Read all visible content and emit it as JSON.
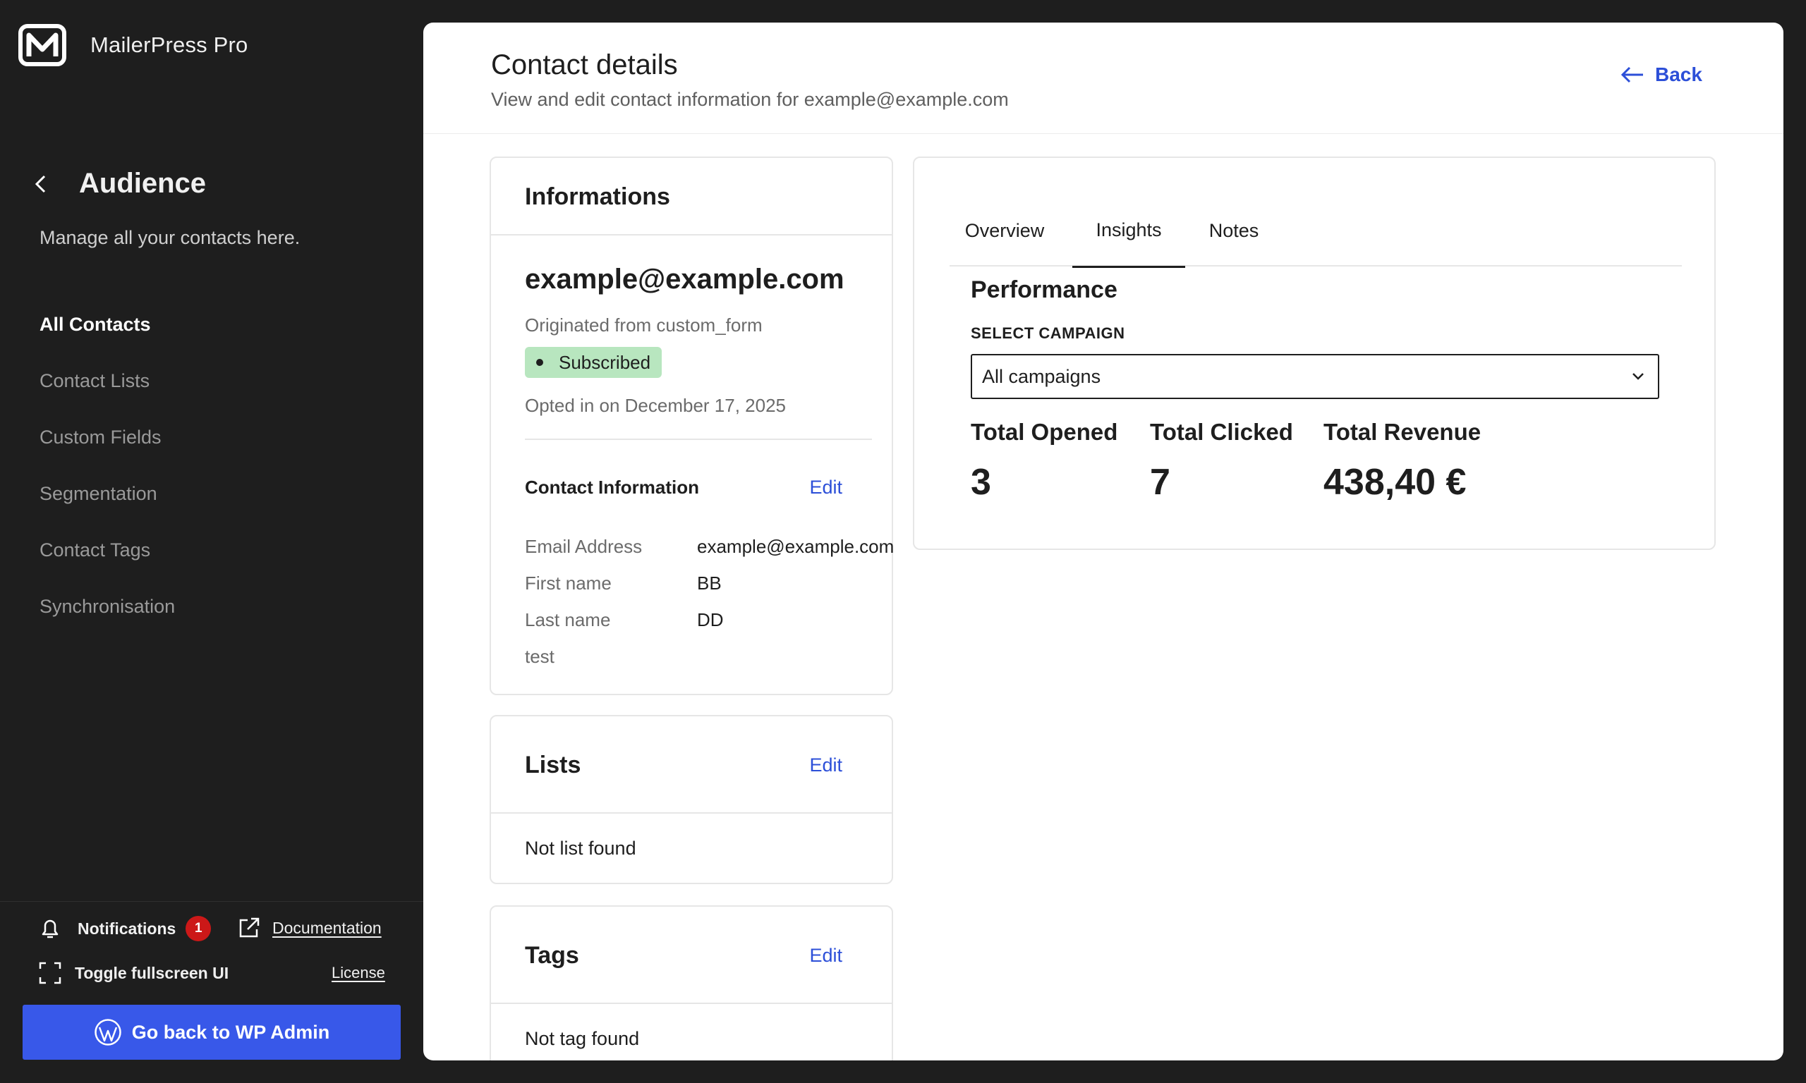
{
  "app": {
    "name": "MailerPress Pro"
  },
  "sidebar": {
    "section_title": "Audience",
    "section_desc": "Manage all your contacts here.",
    "items": [
      {
        "label": "All Contacts",
        "active": true
      },
      {
        "label": "Contact Lists",
        "active": false
      },
      {
        "label": "Custom Fields",
        "active": false
      },
      {
        "label": "Segmentation",
        "active": false
      },
      {
        "label": "Contact Tags",
        "active": false
      },
      {
        "label": "Synchronisation",
        "active": false
      }
    ],
    "footer": {
      "notifications_label": "Notifications",
      "notifications_count": "1",
      "documentation_label": "Documentation",
      "fullscreen_label": "Toggle fullscreen UI",
      "license_label": "License",
      "wp_admin_label": "Go back to WP Admin"
    }
  },
  "header": {
    "title": "Contact details",
    "subtitle": "View and edit contact information for example@example.com",
    "back_label": "Back"
  },
  "info_card": {
    "title": "Informations",
    "email": "example@example.com",
    "origin": "Originated from custom_form",
    "status": "Subscribed",
    "opted_in": "Opted in on December 17, 2025",
    "contact_info_title": "Contact Information",
    "edit_label": "Edit",
    "fields": [
      {
        "label": "Email Address",
        "value": "example@example.com"
      },
      {
        "label": "First name",
        "value": "BB"
      },
      {
        "label": "Last name",
        "value": "DD"
      },
      {
        "label": "test",
        "value": ""
      }
    ]
  },
  "lists_card": {
    "title": "Lists",
    "edit_label": "Edit",
    "empty": "Not list found"
  },
  "tags_card": {
    "title": "Tags",
    "edit_label": "Edit",
    "empty": "Not tag found"
  },
  "perf_card": {
    "tabs": [
      {
        "label": "Overview",
        "active": false
      },
      {
        "label": "Insights",
        "active": true
      },
      {
        "label": "Notes",
        "active": false
      }
    ],
    "title": "Performance",
    "select_label": "SELECT CAMPAIGN",
    "select_value": "All campaigns",
    "stats": [
      {
        "label": "Total Opened",
        "value": "3"
      },
      {
        "label": "Total Clicked",
        "value": "7"
      },
      {
        "label": "Total Revenue",
        "value": "438,40 €"
      }
    ]
  },
  "colors": {
    "accent": "#3858e9",
    "link": "#2c4fd8",
    "sidebar_bg": "#1e1e1e",
    "status_bg": "#b8e6bf",
    "badge": "#cc1818"
  }
}
